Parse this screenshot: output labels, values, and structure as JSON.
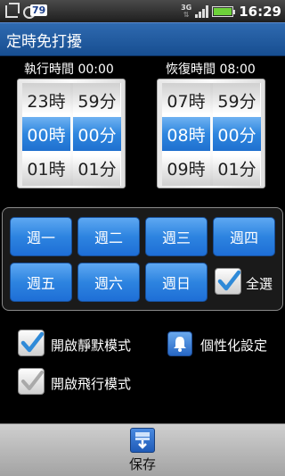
{
  "statusbar": {
    "notification_count": "79",
    "network": "3G",
    "time": "16:29"
  },
  "titlebar": {
    "title": "定時免打擾"
  },
  "start": {
    "label": "執行時間 00:00",
    "hours": [
      "23時",
      "00時",
      "01時"
    ],
    "minutes": [
      "59分",
      "00分",
      "01分"
    ]
  },
  "end": {
    "label": "恢復時間 08:00",
    "hours": [
      "07時",
      "08時",
      "09時"
    ],
    "minutes": [
      "59分",
      "00分",
      "01分"
    ]
  },
  "days": {
    "items": [
      "週一",
      "週二",
      "週三",
      "週四",
      "週五",
      "週六",
      "週日"
    ],
    "select_all_label": "全選",
    "select_all_checked": true
  },
  "options": {
    "silent_mode": {
      "label": "開啟靜默模式",
      "checked": true
    },
    "personalize": {
      "label": "個性化設定"
    },
    "airplane_mode": {
      "label": "開啟飛行模式",
      "checked": false
    }
  },
  "bottom": {
    "save_label": "保存"
  },
  "colors": {
    "accent": "#2d84e0",
    "titlebar": "#2a63ad",
    "check": "#2f8ad8"
  }
}
